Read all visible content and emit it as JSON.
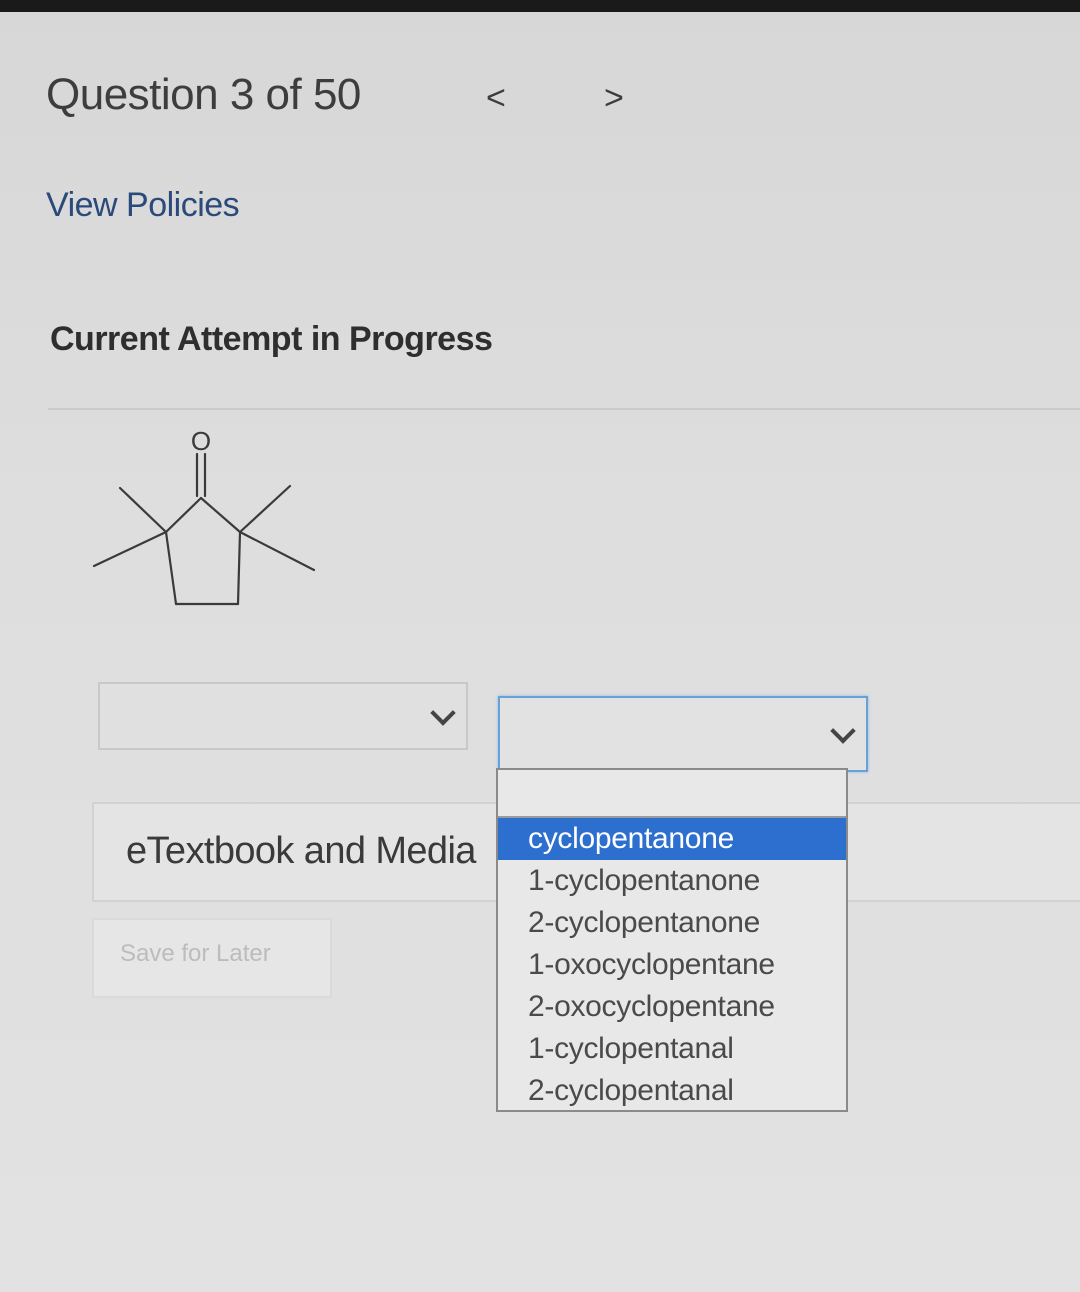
{
  "header": {
    "question_title": "Question 3 of 50",
    "prev_label": "<",
    "next_label": ">"
  },
  "links": {
    "view_policies": "View Policies"
  },
  "attempt": {
    "heading": "Current Attempt in Progress"
  },
  "structure": {
    "atom_label": "O",
    "icon": "2,2-dimethylcyclopentanone-like-skeletal-structure"
  },
  "selects": {
    "first": {
      "value": ""
    },
    "second": {
      "value": "",
      "options": [
        "",
        "cyclopentanone",
        "1-cyclopentanone",
        "2-cyclopentanone",
        "1-oxocyclopentane",
        "2-oxocyclopentane",
        "1-cyclopentanal",
        "2-cyclopentanal"
      ],
      "highlighted_option": "cyclopentanone"
    }
  },
  "resources": {
    "etextbook_label": "eTextbook and Media"
  },
  "actions": {
    "save_label": "Save for Later"
  },
  "colors": {
    "highlight": "#2d6fcf",
    "link": "#2a4a7a",
    "focus_border": "#6aa0d8"
  }
}
